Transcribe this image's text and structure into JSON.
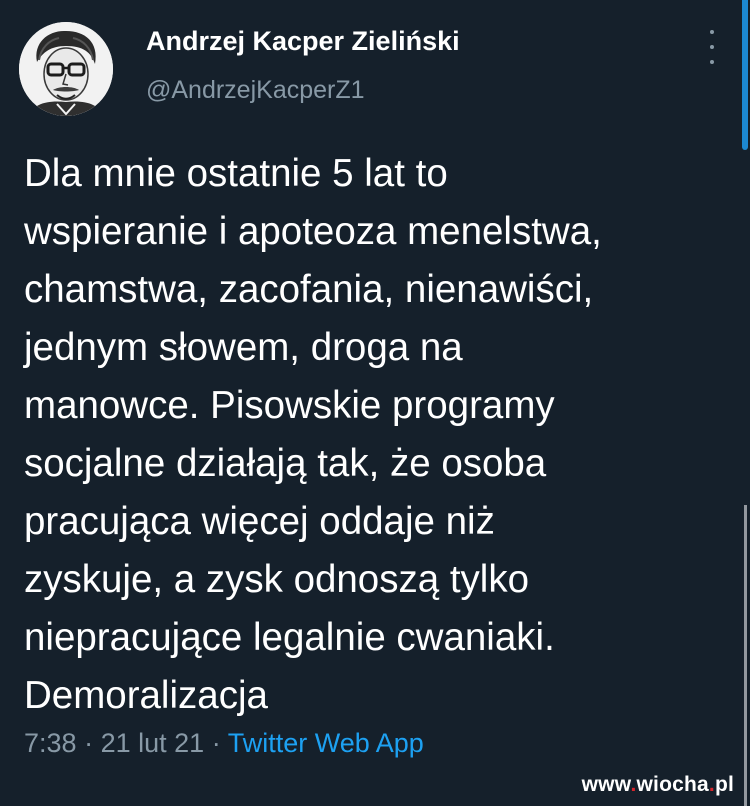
{
  "tweet": {
    "author": {
      "display_name": "Andrzej Kacper Zieliński",
      "handle": "@AndrzejKacperZ1",
      "avatar_icon": "avatar-sketch-portrait"
    },
    "text_lines": [
      "Dla mnie ostatnie 5 lat to",
      "wspieranie i apoteoza menelstwa,",
      "chamstwa, zacofania, nienawiści,",
      "jednym słowem, droga na",
      "manowce. Pisowskie programy",
      "socjalne działają tak, że osoba",
      "pracująca więcej oddaje niż",
      "zyskuje, a zysk odnoszą tylko",
      "niepracujące legalnie cwaniaki.",
      "Demoralizacja"
    ],
    "time": "7:38",
    "separator": "·",
    "date": "21 lut 21",
    "source": "Twitter Web App"
  },
  "menu": {
    "icon": "more-vertical-icon"
  },
  "watermark": {
    "prefix": "www",
    "dot1": ".",
    "name": "wiocha",
    "dot2": ".",
    "tld": "pl"
  },
  "colors": {
    "background": "#15202b",
    "secondary_text": "#8899a6",
    "link": "#1da1f2",
    "watermark_dot": "#d7262c"
  }
}
